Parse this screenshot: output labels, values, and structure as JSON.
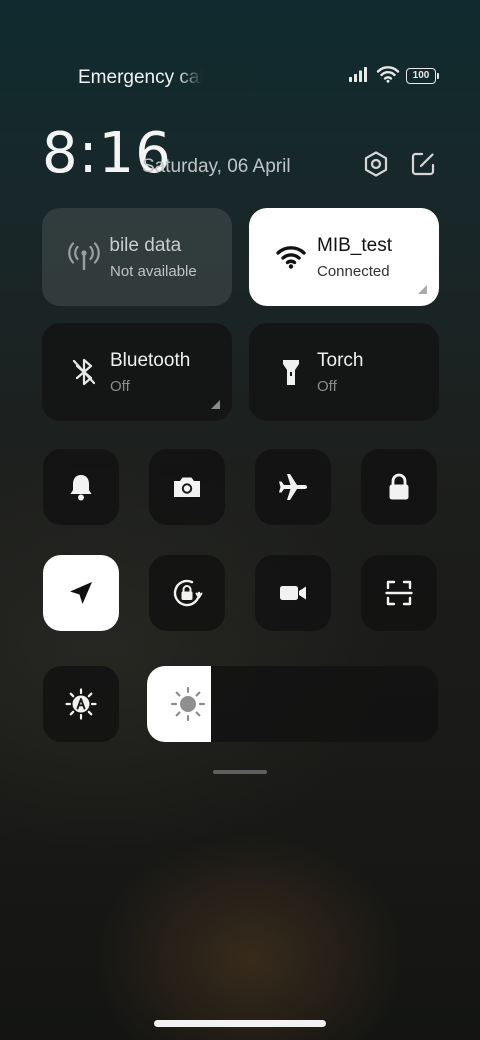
{
  "status_bar": {
    "carrier_text": "Emergency calls only",
    "battery_level": "100",
    "icons": [
      "signal-icon",
      "wifi-icon",
      "battery-icon"
    ]
  },
  "header": {
    "time": "8:16",
    "date": "Saturday, 06 April",
    "icons": [
      "settings-icon",
      "edit-icon"
    ]
  },
  "tiles": {
    "mobile_data": {
      "title": "Mobile data",
      "subtitle": "Not available",
      "state": "disabled",
      "icon": "antenna-icon"
    },
    "wifi": {
      "title": "MIB_test",
      "subtitle": "Connected",
      "state": "on",
      "icon": "wifi-icon"
    },
    "bluetooth": {
      "title": "Bluetooth",
      "subtitle": "Off",
      "state": "off",
      "icon": "bluetooth-icon"
    },
    "torch": {
      "title": "Torch",
      "subtitle": "Off",
      "state": "off",
      "icon": "flashlight-icon"
    }
  },
  "toggles": [
    {
      "name": "ringer",
      "icon": "bell-icon",
      "active": false
    },
    {
      "name": "screenshot",
      "icon": "camera-icon",
      "active": false
    },
    {
      "name": "airplane-mode",
      "icon": "airplane-icon",
      "active": false
    },
    {
      "name": "lock-screen",
      "icon": "lock-icon",
      "active": false
    },
    {
      "name": "location",
      "icon": "location-arrow-icon",
      "active": true
    },
    {
      "name": "auto-rotate",
      "icon": "rotation-lock-icon",
      "active": false
    },
    {
      "name": "screen-recorder",
      "icon": "video-camera-icon",
      "active": false
    },
    {
      "name": "scanner",
      "icon": "scan-icon",
      "active": false
    }
  ],
  "brightness": {
    "auto_icon": "auto-brightness-icon",
    "icon": "sun-icon",
    "level": 0.22
  },
  "colors": {
    "active_tile": "#ffffff",
    "inactive_tile": "#121212",
    "disabled_tile": "#464e4e",
    "subtitle_gray": "#8a8d8d"
  }
}
